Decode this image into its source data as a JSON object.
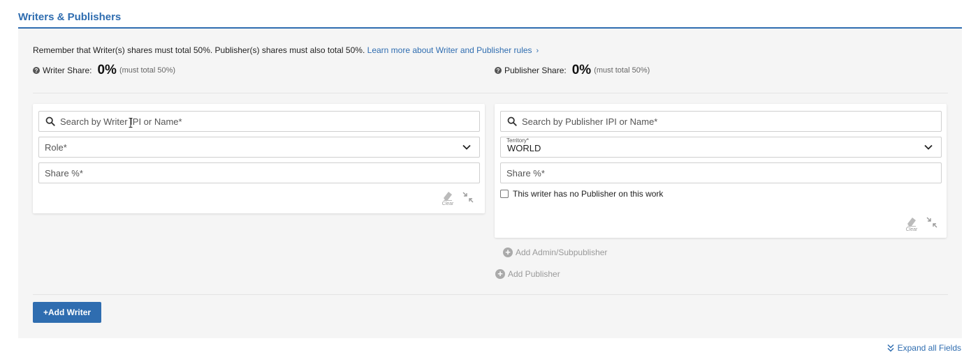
{
  "section": {
    "title": "Writers & Publishers"
  },
  "notice": {
    "text": "Remember that Writer(s) shares must total 50%. Publisher(s) shares must also total 50%.",
    "link": "Learn more about Writer and Publisher rules",
    "chevron": "›"
  },
  "writer_share": {
    "label": "Writer Share:",
    "value": "0%",
    "hint": "(must total 50%)"
  },
  "publisher_share": {
    "label": "Publisher Share:",
    "value": "0%",
    "hint": "(must total 50%)"
  },
  "writer_card": {
    "search_placeholder": "Search by Writer IPI or Name*",
    "role_placeholder": "Role*",
    "share_placeholder": "Share %*",
    "clear_label": "Clear"
  },
  "publisher_card": {
    "search_placeholder": "Search by Publisher IPI or Name*",
    "territory_label": "Territory*",
    "territory_value": "WORLD",
    "share_placeholder": "Share %*",
    "no_publisher_label": "This writer has no Publisher on this work",
    "no_publisher_checked": false,
    "clear_label": "Clear"
  },
  "actions": {
    "add_admin": "Add Admin/Subpublisher",
    "add_publisher": "Add Publisher",
    "add_writer": "+Add Writer",
    "expand_all": "Expand all Fields"
  },
  "colors": {
    "accent": "#2f6db0",
    "panel_bg": "#f5f5f5",
    "muted": "#9a9a9a"
  },
  "icons": [
    "help-icon",
    "search-icon",
    "chevron-down-icon",
    "eraser-icon",
    "collapse-icon",
    "plus-circle-icon",
    "double-chevron-down-icon"
  ]
}
